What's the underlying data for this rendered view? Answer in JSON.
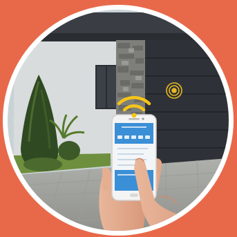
{
  "scene": {
    "background_color": "#E8694A",
    "ring_color": "#FFFFFF",
    "wifi_color": "#F5C518",
    "signal_color": "#E8B820",
    "door_color": "#2E3238",
    "wall_color": "#D9DCDD",
    "stone_color": "#7E7E7B",
    "sky_color": "#C9D2D6",
    "app_header_color": "#3B8FD6",
    "app_body_color": "#F3F6F9"
  },
  "icons": {
    "wifi": "wifi-icon",
    "signal": "signal-icon"
  }
}
